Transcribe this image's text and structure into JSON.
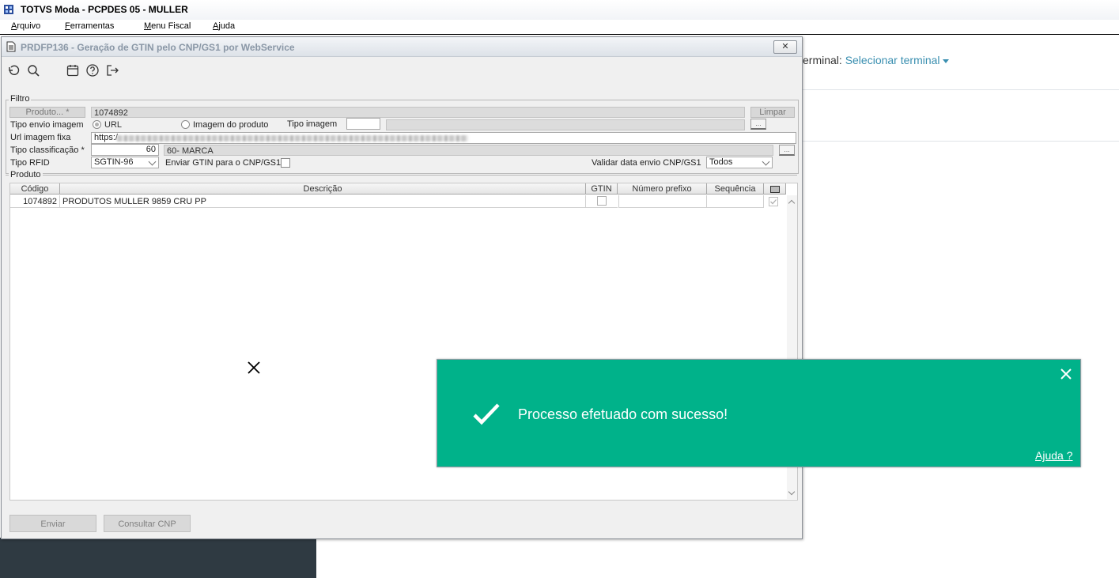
{
  "app": {
    "title": "TOTVS Moda - PCPDES 05 - MULLER",
    "menu": [
      "Arquivo",
      "Ferramentas",
      "Menu Fiscal",
      "Ajuda"
    ],
    "menu_accelerators": [
      "A",
      "F",
      "M",
      "A"
    ]
  },
  "background": {
    "terminal_prefix": "erminal:",
    "terminal_link": "Selecionar terminal"
  },
  "dialog": {
    "title": "PRDFP136 - Geração de GTIN pelo CNP/GS1 por WebService",
    "close_label": "✕",
    "toolbar_icons": [
      "undo-icon",
      "search-icon",
      "calendar-icon",
      "help-icon",
      "exit-icon"
    ],
    "filtro": {
      "legend": "Filtro",
      "produto_label": "Produto... *",
      "produto_value": "1074892",
      "limpar_label": "Limpar",
      "tipo_envio_label": "Tipo envio imagem",
      "radio_url": "URL",
      "radio_imagem": "Imagem do produto",
      "tipo_imagem_label": "Tipo imagem",
      "url_label": "Url imagem fixa",
      "url_value": "https:/",
      "tipo_class_label": "Tipo classificação *",
      "tipo_class_value": "60",
      "tipo_class_desc": "60- MARCA",
      "tipo_rfid_label": "Tipo RFID",
      "tipo_rfid_value": "SGTIN-96",
      "enviar_gtin_label": "Enviar GTIN para o CNP/GS1",
      "validar_label": "Validar data envio CNP/GS1",
      "validar_value": "Todos",
      "lookup_label": "..."
    },
    "produto": {
      "legend": "Produto",
      "columns": [
        "Código",
        "Descrição",
        "GTIN",
        "Número prefixo",
        "Sequência"
      ],
      "rows": [
        {
          "codigo": "1074892",
          "descricao": "PRODUTOS MULLER 9859 CRU PP",
          "gtin": "",
          "prefixo": "",
          "sequencia": ""
        }
      ]
    },
    "buttons": {
      "enviar": "Enviar",
      "consultar": "Consultar CNP"
    }
  },
  "toast": {
    "message": "Processo efetuado com sucesso!",
    "help_link": "Ajuda ?",
    "bg_color": "#00b28a"
  }
}
